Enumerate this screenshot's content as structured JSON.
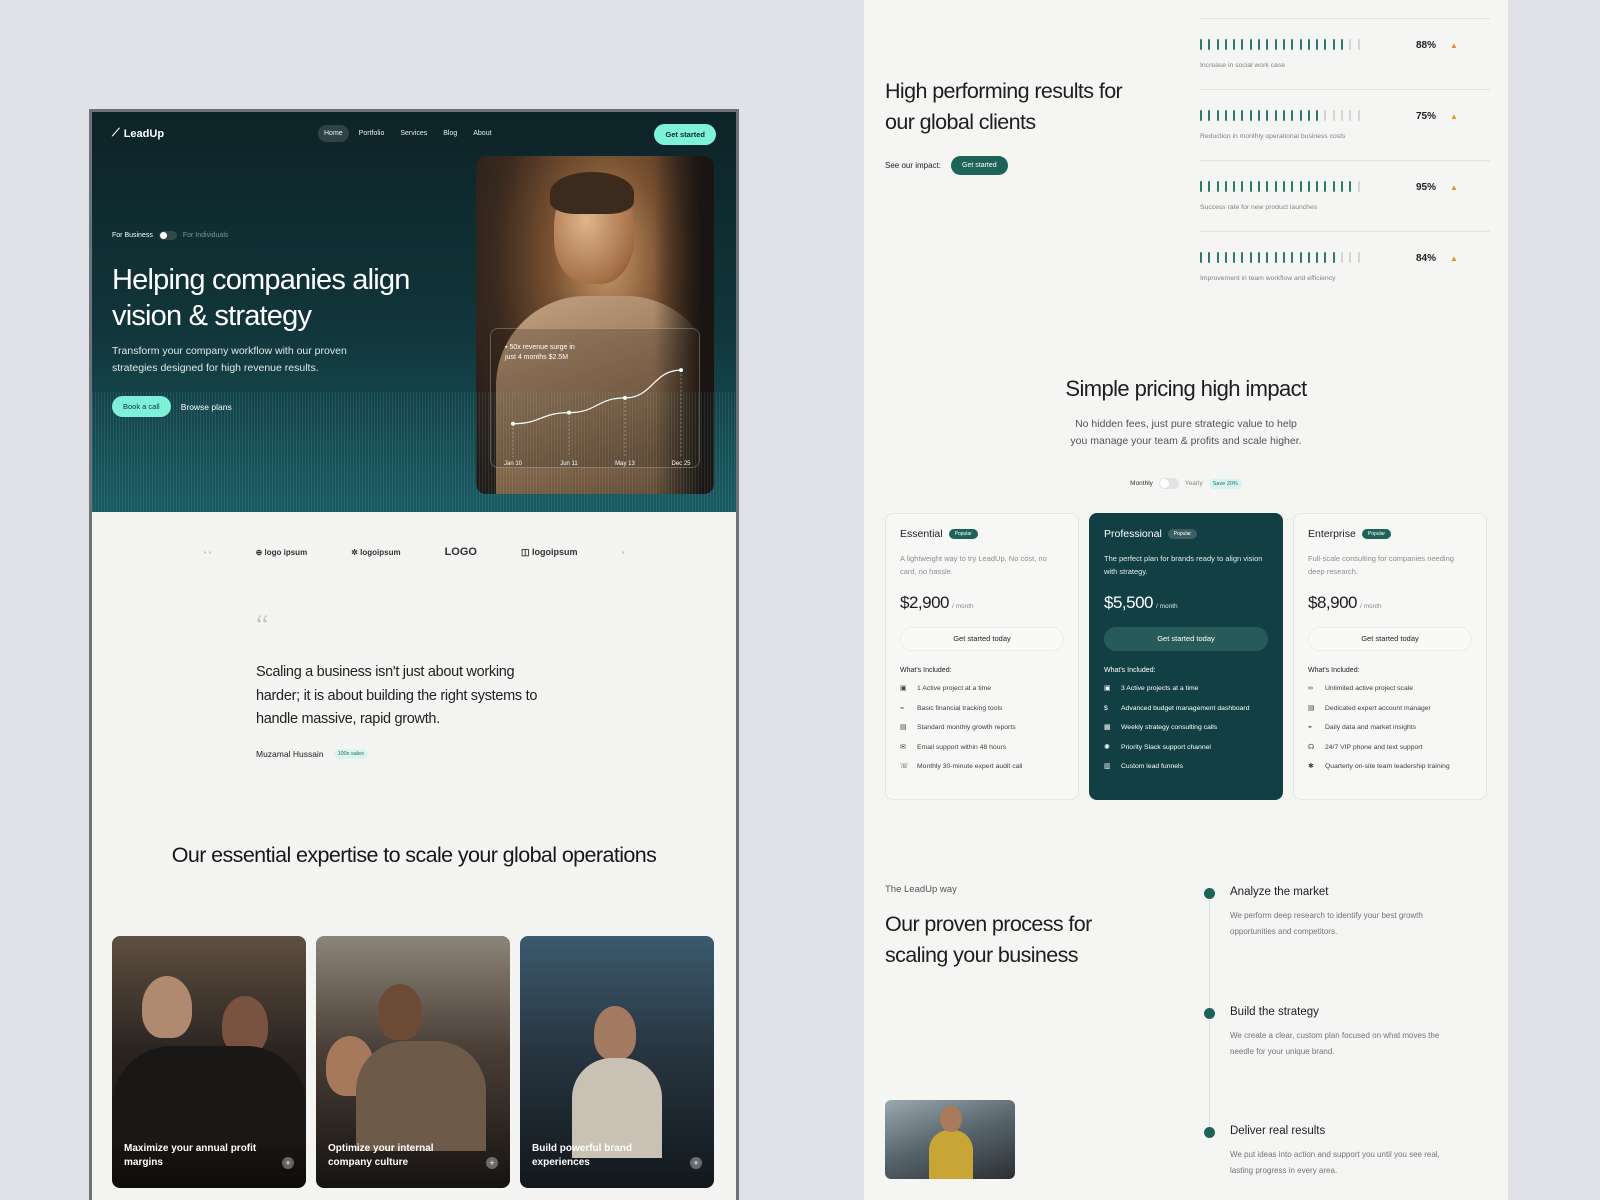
{
  "nav": {
    "brand": "LeadUp",
    "links": [
      "Home",
      "Portfolio",
      "Services",
      "Blog",
      "About"
    ],
    "cta": "Get started"
  },
  "hero": {
    "toggle_left": "For Business",
    "toggle_right": "For Individuals",
    "title": "Helping companies align vision & strategy",
    "subtitle": "Transform your company workflow with our proven strategies designed for high revenue results.",
    "primary": "Book a call",
    "secondary": "Browse plans",
    "chart_label": "50x revenue surge in just 4 months $2.5M",
    "chart_ticks": [
      "Jan 10",
      "Jun 11",
      "May 13",
      "Dec 25"
    ]
  },
  "logos": [
    "logo ipsum",
    "logoipsum",
    "LOGO",
    "logoipsum"
  ],
  "quote": {
    "mark": "“",
    "text": "Scaling a business isn't just about working harder; it is about building the right systems to handle massive, rapid growth.",
    "author": "Muzamal Hussain",
    "badge": "100x sales"
  },
  "expertise": {
    "title": "Our essential expertise to scale your global operations",
    "cards": [
      "Maximize your annual profit margins",
      "Optimize your internal company culture",
      "Build powerful brand experiences"
    ]
  },
  "results": {
    "title": "High performing results for our global clients",
    "impact_label": "See our impact:",
    "impact_cta": "Get started",
    "stats": [
      {
        "pct": "88%",
        "fill": 0.88,
        "desc": "Increase in social work case"
      },
      {
        "pct": "75%",
        "fill": 0.75,
        "desc": "Reduction in monthly operational business costs"
      },
      {
        "pct": "95%",
        "fill": 0.95,
        "desc": "Success rate for new product launches"
      },
      {
        "pct": "84%",
        "fill": 0.84,
        "desc": "Improvement in team workflow and efficiency"
      }
    ]
  },
  "pricing": {
    "title": "Simple pricing high impact",
    "subtitle": "No hidden fees, just pure strategic value to help you manage your team & profits and scale higher.",
    "monthly": "Monthly",
    "yearly": "Yearly",
    "save": "Save 20%",
    "plans": [
      {
        "name": "Essential",
        "badge": "Popular",
        "desc": "A lightweight way to try LeadUp. No cost, no card, no hassle.",
        "price": "$2,900",
        "per": "/ month",
        "cta": "Get started today",
        "incl": "What's Included:",
        "features": [
          "1 Active project at a time",
          "Basic financial tracking tools",
          "Standard monthly growth reports",
          "Email support within 48 hours",
          "Monthly 30-minute expert audit call"
        ]
      },
      {
        "name": "Professional",
        "badge": "Popular",
        "desc": "The perfect plan for brands ready to align vision with strategy.",
        "price": "$5,500",
        "per": "/ month",
        "cta": "Get started today",
        "incl": "What's Included:",
        "features": [
          "3 Active projects at a time",
          "Advanced budget management dashboard",
          "Weekly strategy consulting calls",
          "Priority Slack support channel",
          "Custom lead funnels"
        ]
      },
      {
        "name": "Enterprise",
        "badge": "Popular",
        "desc": "Full-scale consulting for companies needing deep research.",
        "price": "$8,900",
        "per": "/ month",
        "cta": "Get started today",
        "incl": "What's Included:",
        "features": [
          "Unlimited active project scale",
          "Dedicated expert account manager",
          "Daily data and market insights",
          "24/7 VIP phone and text support",
          "Quarterly on-site team leadership training"
        ]
      }
    ]
  },
  "process": {
    "eyebrow": "The LeadUp way",
    "title": "Our proven process for scaling your business",
    "steps": [
      {
        "title": "Analyze the market",
        "desc": "We perform deep research to identify your best growth opportunities and competitors."
      },
      {
        "title": "Build the strategy",
        "desc": "We create a clear, custom plan focused on what moves the needle for your unique brand."
      },
      {
        "title": "Deliver real results",
        "desc": "We put ideas into action and support you until you see real, lasting progress in every area."
      }
    ]
  },
  "icons": {
    "brand": "leadup-logo-icon",
    "plus": "plus-icon",
    "arrow": "arrow-up-icon"
  },
  "colors": {
    "accent": "#7ef2da",
    "brand_dark": "#123f43",
    "brand_green": "#1e6358"
  },
  "chart_data": {
    "type": "line",
    "categories": [
      "Jan 10",
      "Jun 11",
      "May 13",
      "Dec 25"
    ],
    "values": [
      10,
      22,
      38,
      68
    ],
    "title": "",
    "ylim": [
      0,
      80
    ]
  }
}
